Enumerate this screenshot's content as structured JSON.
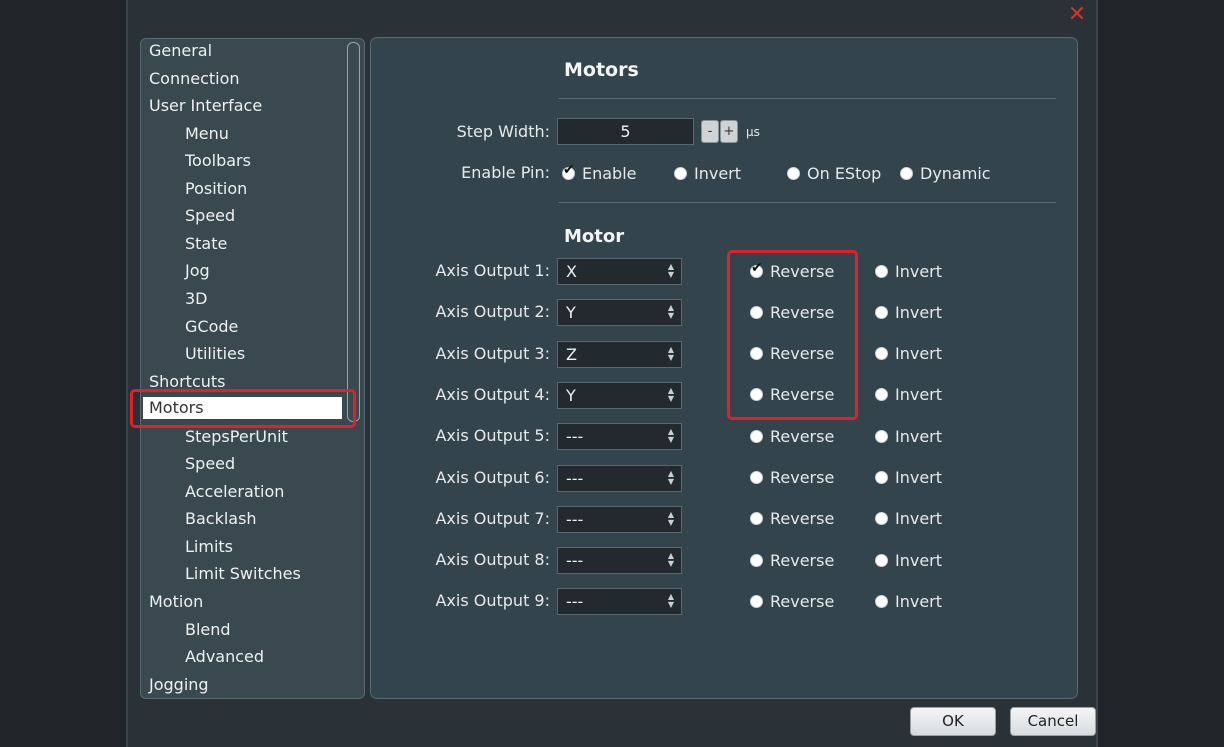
{
  "window": {
    "close_icon": "close-icon",
    "accent_color": "#e0202a"
  },
  "sidebar": {
    "items": [
      {
        "label": "General",
        "level": 0
      },
      {
        "label": "Connection",
        "level": 0
      },
      {
        "label": "User Interface",
        "level": 0
      },
      {
        "label": "Menu",
        "level": 1
      },
      {
        "label": "Toolbars",
        "level": 1
      },
      {
        "label": "Position",
        "level": 1
      },
      {
        "label": "Speed",
        "level": 1
      },
      {
        "label": "State",
        "level": 1
      },
      {
        "label": "Jog",
        "level": 1
      },
      {
        "label": "3D",
        "level": 1
      },
      {
        "label": "GCode",
        "level": 1
      },
      {
        "label": "Utilities",
        "level": 1
      },
      {
        "label": "Shortcuts",
        "level": 0
      },
      {
        "label": "Motors",
        "level": 0,
        "selected": true
      },
      {
        "label": "StepsPerUnit",
        "level": 1
      },
      {
        "label": "Speed",
        "level": 1
      },
      {
        "label": "Acceleration",
        "level": 1
      },
      {
        "label": "Backlash",
        "level": 1
      },
      {
        "label": "Limits",
        "level": 1
      },
      {
        "label": "Limit Switches",
        "level": 1
      },
      {
        "label": "Motion",
        "level": 0
      },
      {
        "label": "Blend",
        "level": 1
      },
      {
        "label": "Advanced",
        "level": 1
      },
      {
        "label": "Jogging",
        "level": 0
      }
    ]
  },
  "panel": {
    "title": "Motors",
    "step_width": {
      "label": "Step Width:",
      "value": "5",
      "minus": "-",
      "plus": "+",
      "unit": "µs"
    },
    "enable_pin": {
      "label": "Enable Pin:",
      "options": [
        {
          "label": "Enable",
          "checked": true
        },
        {
          "label": "Invert",
          "checked": false
        },
        {
          "label": "On EStop",
          "checked": false
        },
        {
          "label": "Dynamic",
          "checked": false
        }
      ]
    },
    "motor_section": "Motor",
    "reverse_label": "Reverse",
    "invert_label": "Invert",
    "axis_outputs": [
      {
        "label": "Axis Output 1:",
        "value": "X",
        "reverse": true,
        "invert": false
      },
      {
        "label": "Axis Output 2:",
        "value": "Y",
        "reverse": false,
        "invert": false
      },
      {
        "label": "Axis Output 3:",
        "value": "Z",
        "reverse": false,
        "invert": false
      },
      {
        "label": "Axis Output 4:",
        "value": "Y",
        "reverse": false,
        "invert": false
      },
      {
        "label": "Axis Output 5:",
        "value": "---",
        "reverse": false,
        "invert": false
      },
      {
        "label": "Axis Output 6:",
        "value": "---",
        "reverse": false,
        "invert": false
      },
      {
        "label": "Axis Output 7:",
        "value": "---",
        "reverse": false,
        "invert": false
      },
      {
        "label": "Axis Output 8:",
        "value": "---",
        "reverse": false,
        "invert": false
      },
      {
        "label": "Axis Output 9:",
        "value": "---",
        "reverse": false,
        "invert": false
      }
    ]
  },
  "footer": {
    "ok_label": "OK",
    "cancel_label": "Cancel"
  }
}
